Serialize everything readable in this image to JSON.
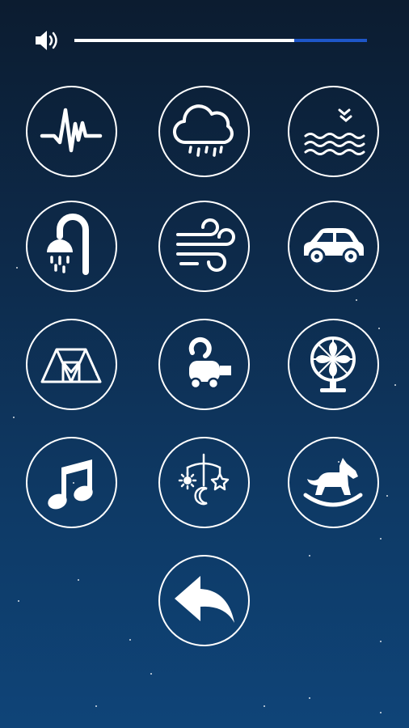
{
  "volume": {
    "icon": "speaker-volume-icon",
    "level": 0.75
  },
  "sounds": [
    {
      "name": "heartbeat-icon"
    },
    {
      "name": "rain-cloud-icon"
    },
    {
      "name": "ocean-waves-icon"
    },
    {
      "name": "shower-icon"
    },
    {
      "name": "wind-icon"
    },
    {
      "name": "car-icon"
    },
    {
      "name": "tent-icon"
    },
    {
      "name": "vacuum-cleaner-icon"
    },
    {
      "name": "fan-icon"
    },
    {
      "name": "music-note-icon"
    },
    {
      "name": "baby-mobile-icon"
    },
    {
      "name": "rocking-horse-icon"
    }
  ],
  "back": {
    "icon": "back-arrow-icon"
  },
  "colors": {
    "background_top": "#0c1c30",
    "background_bottom": "#0f4478",
    "slider_track": "#1e56c8",
    "foreground": "#ffffff"
  }
}
